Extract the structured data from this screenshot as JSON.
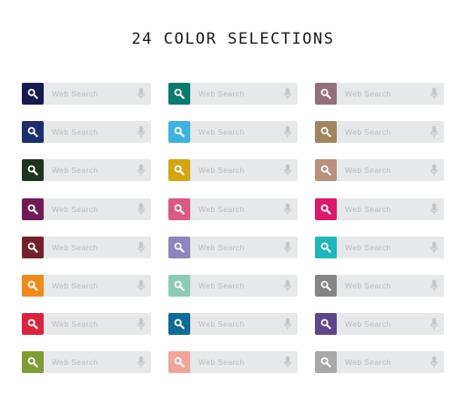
{
  "title": "24 COLOR SELECTIONS",
  "search_placeholder": "Web Search",
  "icons": {
    "search": "magnifier-icon",
    "voice": "microphone-icon"
  },
  "columns": [
    {
      "colors": [
        "#171a4c",
        "#1d2e6e",
        "#1f3323",
        "#6e1b58",
        "#72202c",
        "#ef8a1e",
        "#d8233d",
        "#7e9c35"
      ]
    },
    {
      "colors": [
        "#0d7a70",
        "#40b2e2",
        "#d3a514",
        "#d95a83",
        "#8d86bd",
        "#8ecbb4",
        "#0e6b98",
        "#efa59d"
      ]
    },
    {
      "colors": [
        "#93717b",
        "#a0855d",
        "#b99080",
        "#dc1869",
        "#1fb5bb",
        "#858585",
        "#5c4789",
        "#a8a8a8"
      ]
    }
  ]
}
